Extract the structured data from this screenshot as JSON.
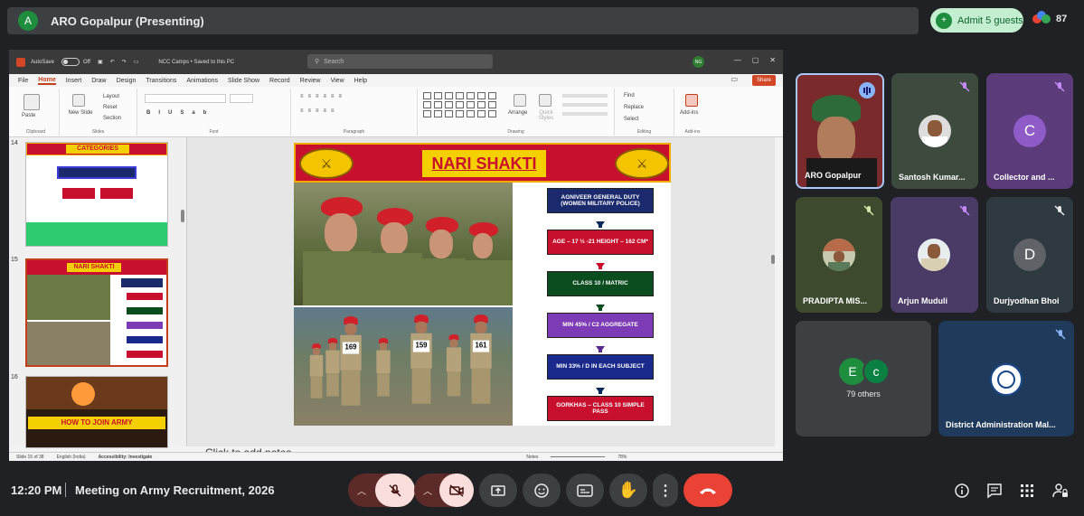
{
  "meeting": {
    "presenter_title": "ARO Gopalpur (Presenting)",
    "presenter_initial": "A",
    "admit_label": "Admit 5 guests",
    "participant_count": "87",
    "time": "12:20 PM",
    "name": "Meeting on Army Recruitment, 2026"
  },
  "ppt": {
    "autosave": "AutoSave",
    "autosave_state": "Off",
    "doc_title": "NCC Camps • Saved to this PC",
    "search_placeholder": "Search",
    "user_initials": "NG",
    "tabs": [
      "File",
      "Home",
      "Insert",
      "Draw",
      "Design",
      "Transitions",
      "Animations",
      "Slide Show",
      "Record",
      "Review",
      "View",
      "Help"
    ],
    "share": "Share",
    "groups": {
      "clipboard": "Clipboard",
      "paste": "Paste",
      "slides": "Slides",
      "new_slide": "New Slide",
      "layout": "Layout",
      "reset": "Reset",
      "section": "Section",
      "font": "Font",
      "paragraph": "Paragraph",
      "drawing": "Drawing",
      "arrange": "Arrange",
      "quick_styles": "Quick Styles",
      "editing": "Editing",
      "find": "Find",
      "replace": "Replace",
      "select": "Select",
      "addins_label": "Add-ins",
      "addins": "Add-ins"
    },
    "thumbs": [
      {
        "num": "14",
        "title": "CATEGORIES"
      },
      {
        "num": "15",
        "title": "NARI SHAKTI"
      },
      {
        "num": "16",
        "title": "HOW TO JOIN ARMY"
      }
    ],
    "notes_placeholder": "Click to add notes",
    "status": {
      "slide": "Slide 15 of 38",
      "language": "English (India)",
      "accessibility": "Accessibility: Investigate",
      "notes": "Notes",
      "zoom": "78%"
    }
  },
  "slide": {
    "title": "NARI SHAKTI",
    "flow": [
      {
        "text": "AGNIVEER GENERAL DUTY (WOMEN MILITARY POLICE)",
        "color": "#1a2a6c"
      },
      {
        "text": "AGE – 17 ½ -21 HEIGHT – 162 CM*",
        "color": "#c8102e"
      },
      {
        "text": "CLASS 10 / MATRIC",
        "color": "#0b4d1e"
      },
      {
        "text": "MIN 45% / C2 AGGREGATE",
        "color": "#7d3cb5"
      },
      {
        "text": "MIN 33% / D IN EACH SUBJECT",
        "color": "#1a2a8c"
      },
      {
        "text": "GORKHAS – CLASS 10 SIMPLE PASS",
        "color": "#c8102e"
      }
    ],
    "arrow_colors": [
      "#0b2a5c",
      "#c8102e",
      "#0b4d1e",
      "#5a2a8c",
      "#0b2a5c"
    ],
    "bibs": [
      "169",
      "159",
      "161"
    ]
  },
  "participants": [
    {
      "name": "ARO Gopalpur",
      "type": "video"
    },
    {
      "name": "Santosh Kumar...",
      "type": "photo"
    },
    {
      "name": "Collector and ...",
      "type": "initial",
      "initial": "C",
      "color": "#8e5bc8"
    },
    {
      "name": "PRADIPTA MIS...",
      "type": "photo"
    },
    {
      "name": "Arjun Muduli",
      "type": "photo"
    },
    {
      "name": "Durjyodhan Bhoi",
      "type": "initial",
      "initial": "D",
      "color": "#5f6368"
    },
    {
      "name": "79 others",
      "type": "others",
      "initials": [
        "E",
        "c"
      ]
    },
    {
      "name": "District Administration Mal...",
      "type": "logo"
    }
  ],
  "colors": {
    "admit_bg": "#c4eed0",
    "end_call": "#ea4335",
    "tile_purple": "#5b3b7a",
    "tile_green": "#3d4a2e",
    "tile_blue": "#1f3a5a"
  }
}
